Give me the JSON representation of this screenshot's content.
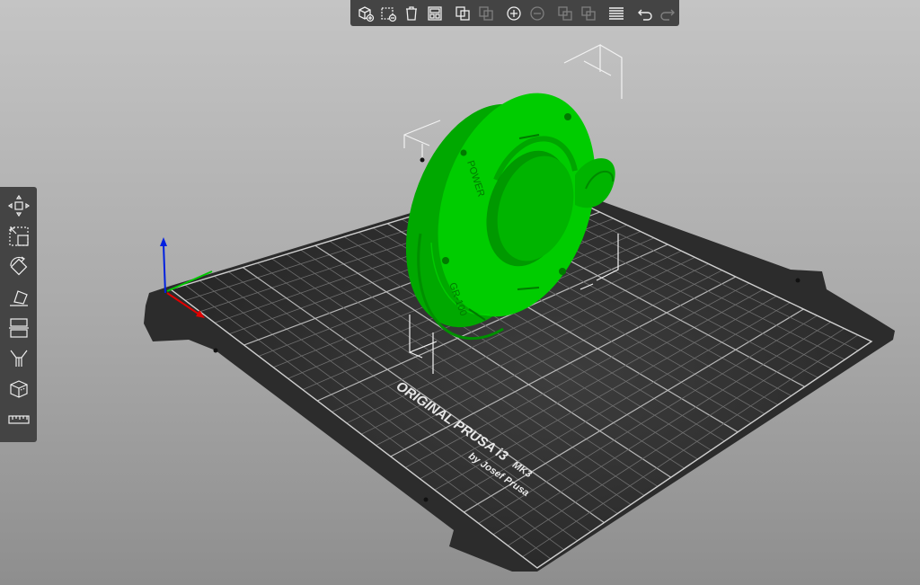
{
  "bed": {
    "title": "ORIGINAL PRUSA i3",
    "model": "MK3",
    "author": "by Josef Prusa"
  },
  "object": {
    "engraving_top": "POWER",
    "engraving_bottom": "GR-100",
    "color": "#00cc00"
  },
  "colors": {
    "toolbar_bg": "#444444",
    "bed_plate": "#2e2e2e",
    "axis_x": "#e00000",
    "axis_y": "#00c800",
    "axis_z": "#0020e0"
  },
  "top_toolbar": {
    "items": [
      {
        "icon": "add-cube-icon",
        "enabled": true
      },
      {
        "icon": "delete-dashed-cube-icon",
        "enabled": true
      },
      {
        "icon": "trash-icon",
        "enabled": true
      },
      {
        "icon": "arrange-icon",
        "enabled": true
      },
      {
        "icon": "copy-icon",
        "enabled": true
      },
      {
        "icon": "paste-icon",
        "enabled": false
      },
      {
        "icon": "add-instance-icon",
        "enabled": true
      },
      {
        "icon": "remove-instance-icon",
        "enabled": false
      },
      {
        "icon": "split-objects-icon",
        "enabled": false
      },
      {
        "icon": "split-parts-icon",
        "enabled": false
      },
      {
        "icon": "layers-icon",
        "enabled": true
      },
      {
        "icon": "undo-icon",
        "enabled": true
      },
      {
        "icon": "redo-icon",
        "enabled": false
      }
    ]
  },
  "left_toolbar": {
    "items": [
      {
        "icon": "move-icon"
      },
      {
        "icon": "scale-icon"
      },
      {
        "icon": "rotate-icon"
      },
      {
        "icon": "place-on-face-icon"
      },
      {
        "icon": "cut-icon"
      },
      {
        "icon": "support-painting-icon"
      },
      {
        "icon": "seam-painting-icon"
      },
      {
        "icon": "measure-icon"
      }
    ]
  }
}
